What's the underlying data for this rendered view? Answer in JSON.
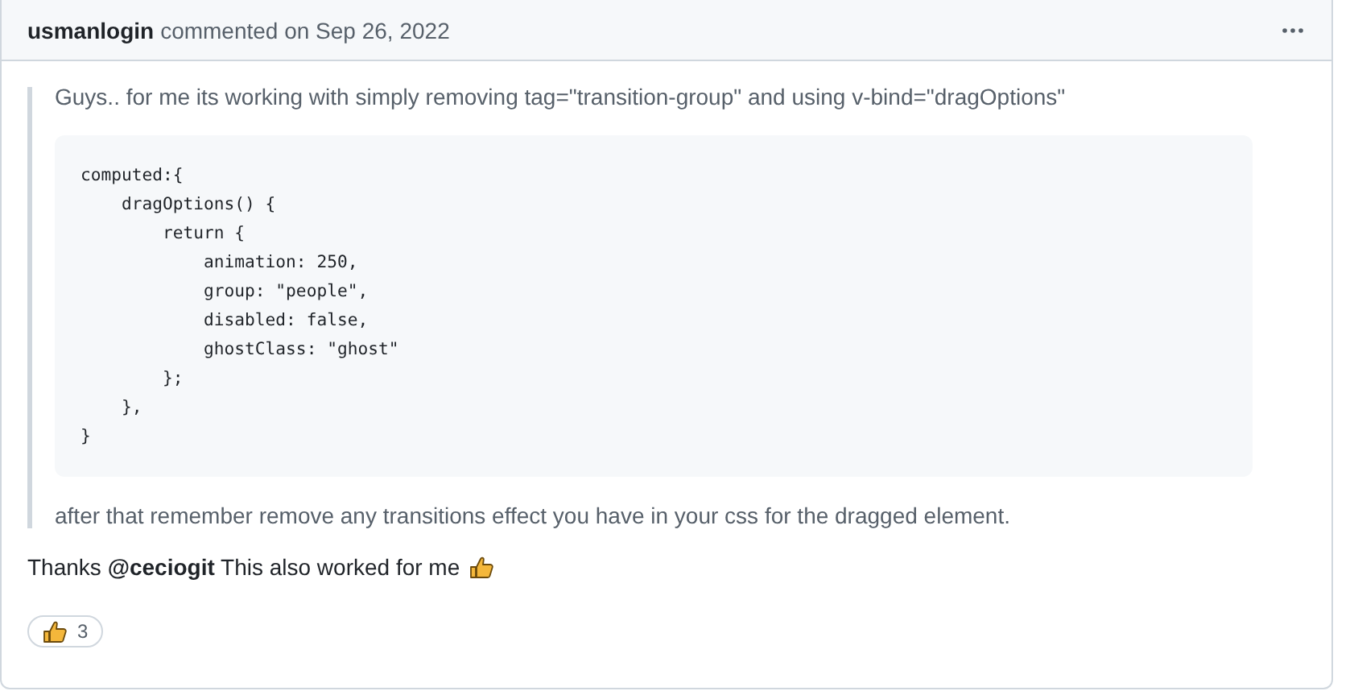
{
  "comment": {
    "author": "usmanlogin",
    "meta": "commented on Sep 26, 2022",
    "quote": {
      "text": "Guys.. for me its working with simply removing tag=\"transition-group\" and using v-bind=\"dragOptions\"",
      "code": "computed:{\n    dragOptions() {\n        return {\n            animation: 250,\n            group: \"people\",\n            disabled: false,\n            ghostClass: \"ghost\"\n        };\n    },\n}",
      "after": "after that remember remove any transitions effect you have in your css for the dragged element."
    },
    "body": "Thanks **@ceciogit** This also worked for me",
    "reactions": [
      {
        "count": "3"
      }
    ]
  }
}
